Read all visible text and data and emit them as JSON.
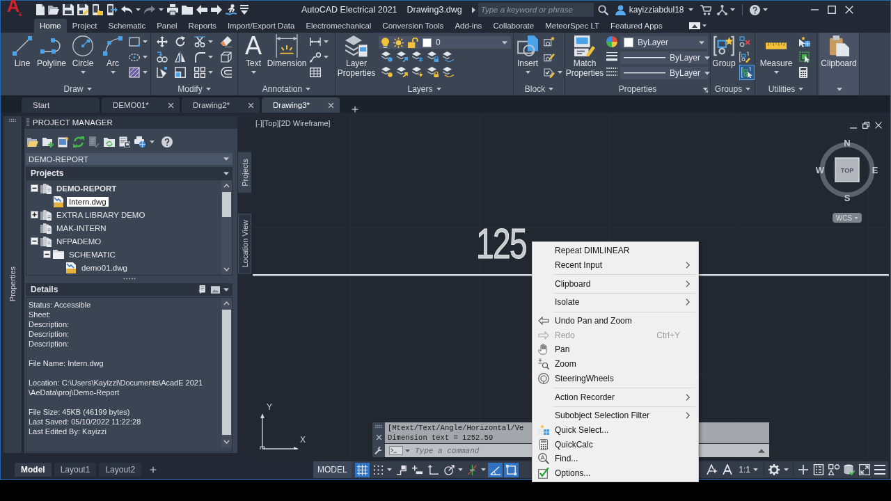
{
  "title_bar": {
    "logo": "A",
    "logo_sub": "E",
    "app_title": "AutoCAD Electrical 2021",
    "document_title": "Drawing3.dwg",
    "search": {
      "placeholder": "Type a keyword or phrase"
    },
    "user": "kayizziabdul18"
  },
  "ribbon_tabs": [
    {
      "label": "Home",
      "selected": true
    },
    {
      "label": "Project",
      "selected": false
    },
    {
      "label": "Schematic",
      "selected": false
    },
    {
      "label": "Panel",
      "selected": false
    },
    {
      "label": "Reports",
      "selected": false
    },
    {
      "label": "Import/Export Data",
      "selected": false
    },
    {
      "label": "Electromechanical",
      "selected": false
    },
    {
      "label": "Conversion Tools",
      "selected": false
    },
    {
      "label": "Add-ins",
      "selected": false
    },
    {
      "label": "Collaborate",
      "selected": false
    },
    {
      "label": "MeteorSpec LT",
      "selected": false
    },
    {
      "label": "Featured Apps",
      "selected": false
    }
  ],
  "ribbon": {
    "panels": [
      {
        "title": "Draw",
        "buttons": [
          "Line",
          "Polyline",
          "Circle",
          "Arc"
        ]
      },
      {
        "title": "Modify"
      },
      {
        "title": "Annotation",
        "text_glyph": "A",
        "buttons": [
          "Text",
          "Dimension"
        ]
      },
      {
        "title": "Layers",
        "buttons": [
          "Layer Properties"
        ],
        "current_layer": "0"
      },
      {
        "title": "Block",
        "buttons": [
          "Insert"
        ]
      },
      {
        "title": "Properties",
        "buttons": [
          "Match Properties"
        ],
        "dropdowns": [
          "ByLayer",
          "ByLayer",
          "ByLayer"
        ]
      },
      {
        "title": "Groups",
        "buttons": [
          "Group"
        ],
        "selection_toggle": {
          "on": true
        }
      },
      {
        "title": "Utilities",
        "buttons": [
          "Measure"
        ]
      },
      {
        "buttons": [
          "Clipboard"
        ]
      }
    ]
  },
  "document_tabs": [
    {
      "label": "Start",
      "selected": false,
      "closable": false
    },
    {
      "label": "DEMO01*",
      "selected": false,
      "closable": true
    },
    {
      "label": "Drawing2*",
      "selected": false,
      "closable": true
    },
    {
      "label": "Drawing3*",
      "selected": true,
      "closable": true
    }
  ],
  "side_panel_tab": "Properties",
  "project_manager": {
    "title": "PROJECT MANAGER",
    "project_dropdown": "DEMO-REPORT",
    "projects_header": "Projects",
    "tree": [
      {
        "label": "DEMO-REPORT",
        "kind": "project",
        "active": true,
        "selected": false,
        "expanded": true,
        "children": [
          {
            "label": "Intern.dwg",
            "kind": "drawing",
            "selected": true
          }
        ]
      },
      {
        "label": "EXTRA LIBRARY DEMO",
        "kind": "project",
        "active": false,
        "selected": false,
        "expanded": false
      },
      {
        "label": "MAK-INTERN",
        "kind": "project",
        "active": false,
        "selected": false
      },
      {
        "label": "NFPADEMO",
        "kind": "project",
        "active": false,
        "selected": false,
        "expanded": true,
        "children": [
          {
            "label": "SCHEMATIC",
            "kind": "folder",
            "selected": false,
            "expanded": true,
            "children": [
              {
                "label": "demo01.dwg",
                "kind": "drawing",
                "selected": false
              }
            ]
          }
        ]
      }
    ],
    "details_header": "Details",
    "details": [
      [
        "Status: Accessible",
        "Sheet:",
        "Description:",
        "Description:",
        "Description:"
      ],
      [
        "File Name: Intern.dwg"
      ],
      [
        "Location: C:\\Users\\Kayizzi\\Documents\\AcadE 2021",
        "\\AeData\\proj\\Demo-Report"
      ],
      [
        "File Size: 45KB (46199 bytes)",
        "Last Saved: 05/10/2022 11:22:28",
        "Last Edited By: Kayizzi"
      ]
    ]
  },
  "palette_tabs": [
    {
      "label": "Projects",
      "selected": true
    },
    {
      "label": "Location View",
      "selected": false
    }
  ],
  "viewport": {
    "controls": "[-][Top][2D Wireframe]",
    "viewcube": {
      "face": "TOP",
      "north": "N",
      "south": "S",
      "west": "W",
      "east": "E"
    },
    "ucs_menu": "WCS",
    "dimension_text": "125",
    "ucs_icon": {
      "x_axis": "X",
      "y_axis": "Y"
    }
  },
  "command_line": {
    "history": [
      "[Mtext/Text/Angle/Horizontal/Ve",
      "Dimension text = 1252.59"
    ],
    "placeholder": "Type a command"
  },
  "context_menu": {
    "sections": [
      {
        "items": [
          {
            "label": "Repeat DIMLINEAR",
            "submenu": false,
            "disabled": false
          },
          {
            "label": "Recent Input",
            "submenu": true,
            "disabled": false
          }
        ]
      },
      {
        "items": [
          {
            "label": "Clipboard",
            "submenu": true,
            "disabled": false
          }
        ]
      },
      {
        "items": [
          {
            "label": "Isolate",
            "submenu": true,
            "disabled": false
          }
        ]
      },
      {
        "items": [
          {
            "label": "Undo Pan and Zoom",
            "submenu": false,
            "disabled": false
          },
          {
            "label": "Redo",
            "shortcut": "Ctrl+Y",
            "submenu": false,
            "disabled": true
          },
          {
            "label": "Pan",
            "submenu": false,
            "disabled": false
          },
          {
            "label": "Zoom",
            "submenu": false,
            "disabled": false
          },
          {
            "label": "SteeringWheels",
            "submenu": false,
            "disabled": false
          }
        ]
      },
      {
        "items": [
          {
            "label": "Action Recorder",
            "submenu": true,
            "disabled": false
          }
        ]
      },
      {
        "items": [
          {
            "label": "Subobject Selection Filter",
            "submenu": true,
            "disabled": false
          },
          {
            "label": "Quick Select...",
            "submenu": false,
            "disabled": false
          },
          {
            "label": "QuickCalc",
            "submenu": false,
            "disabled": false
          },
          {
            "label": "Find...",
            "submenu": false,
            "disabled": false
          },
          {
            "label": "Options...",
            "submenu": false,
            "disabled": false
          }
        ]
      }
    ]
  },
  "layout_tabs": [
    {
      "label": "Model",
      "selected": true
    },
    {
      "label": "Layout1",
      "selected": false
    },
    {
      "label": "Layout2",
      "selected": false
    }
  ],
  "status_bar": {
    "space": "MODEL",
    "toggles": [
      {
        "on": true
      },
      {
        "on": false
      },
      {
        "on": false
      },
      {
        "on": false
      },
      {
        "on": false
      },
      {
        "on": false
      },
      {
        "on": false
      },
      {
        "on": true
      },
      {
        "on": true
      }
    ],
    "annotation_scale": "1:1"
  }
}
